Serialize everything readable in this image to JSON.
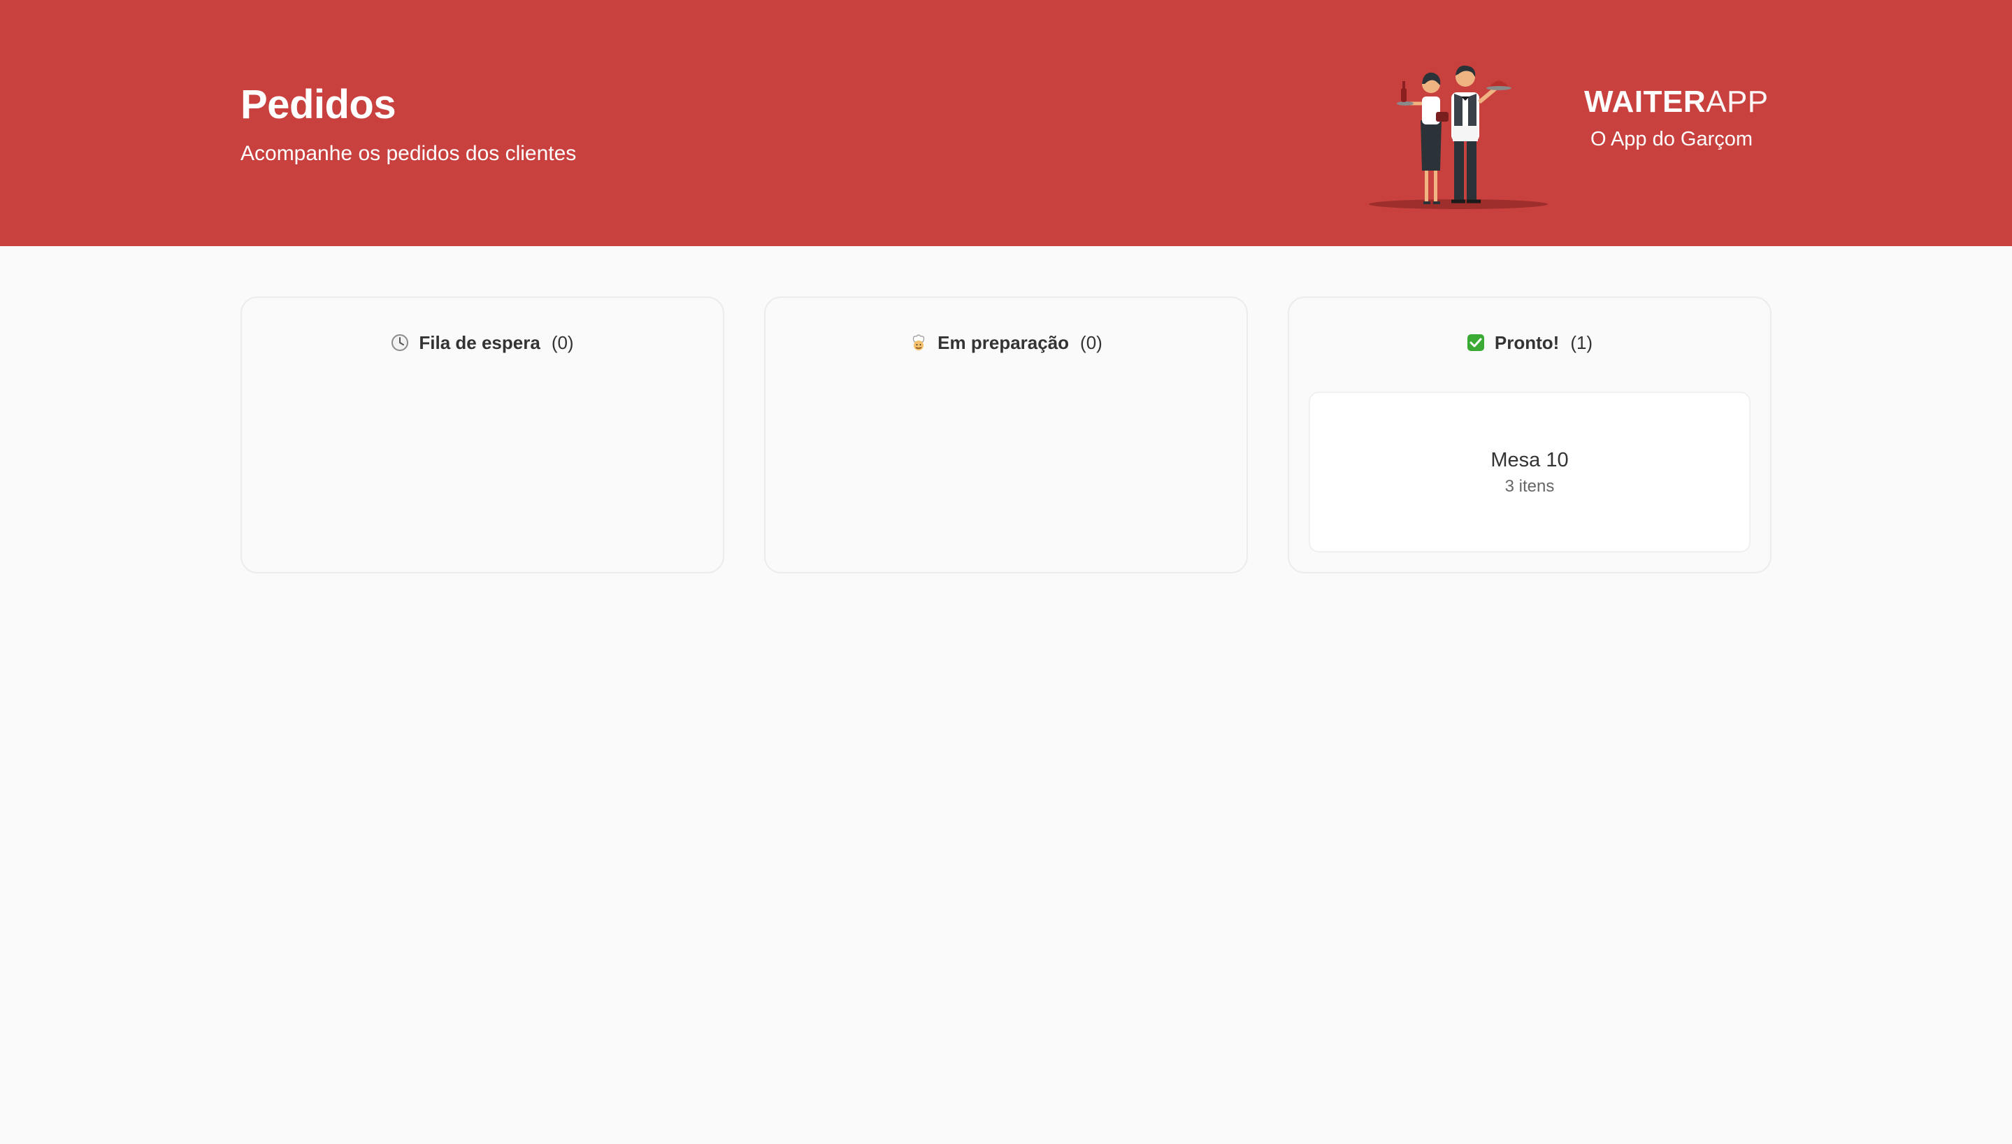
{
  "header": {
    "title": "Pedidos",
    "subtitle": "Acompanhe os pedidos dos clientes",
    "brand_strong": "WAITER",
    "brand_light": "APP",
    "tagline": "O App do Garçom"
  },
  "boards": [
    {
      "icon": "clock-icon",
      "title": "Fila de espera",
      "count": "(0)",
      "orders": []
    },
    {
      "icon": "chef-icon",
      "title": "Em preparação",
      "count": "(0)",
      "orders": []
    },
    {
      "icon": "check-mark-icon",
      "title": "Pronto!",
      "count": "(1)",
      "orders": [
        {
          "table": "Mesa 10",
          "items": "3 itens"
        }
      ]
    }
  ],
  "colors": {
    "brand_red": "#c8413e",
    "background": "#fafafa",
    "card_bg": "#ffffff",
    "check_green": "#3aaa35"
  }
}
